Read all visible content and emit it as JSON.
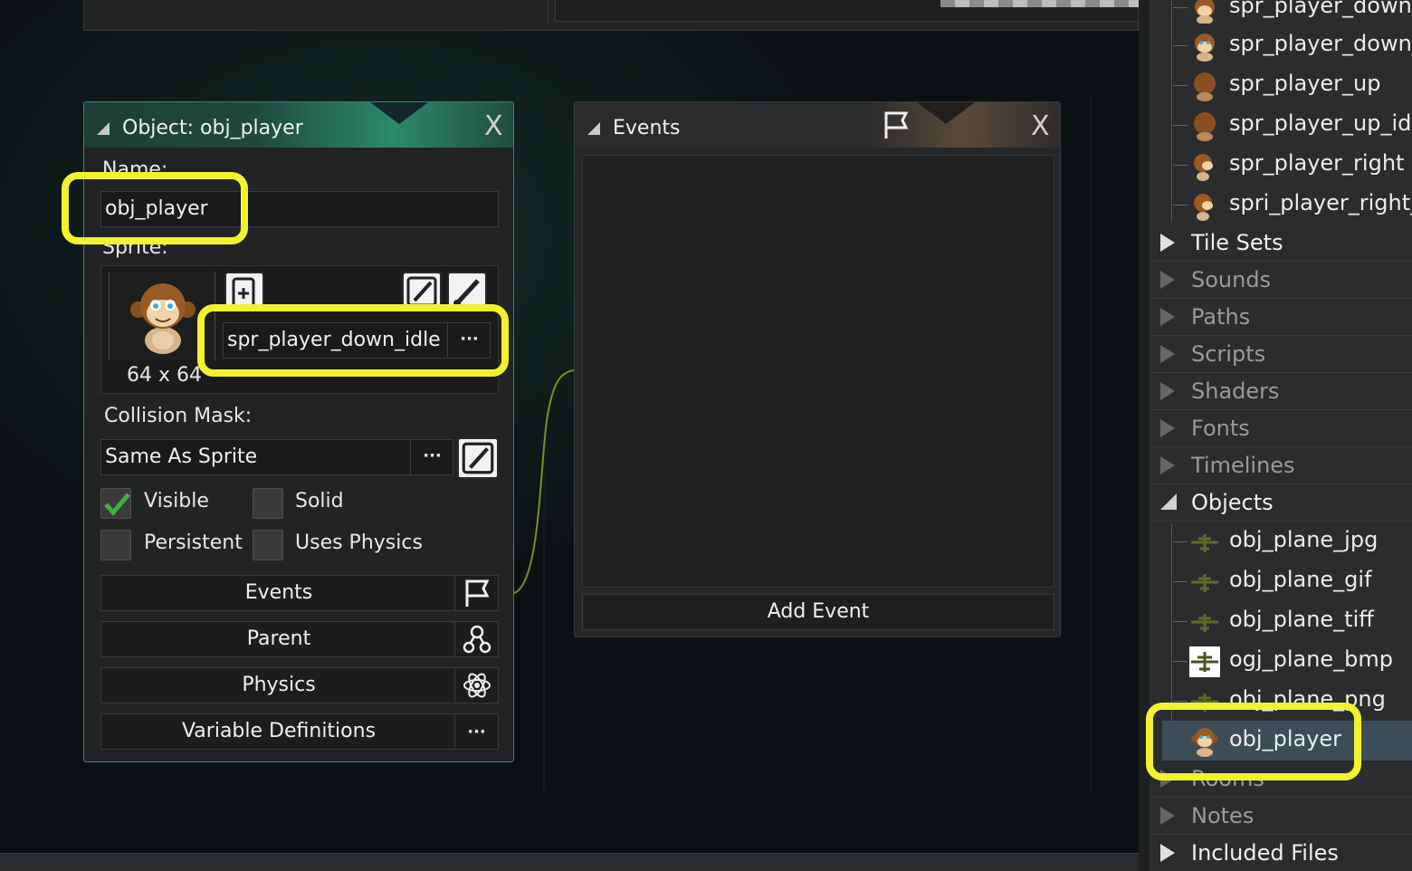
{
  "object_panel": {
    "title": "Object: obj_player",
    "name_label": "Name:",
    "name_value": "obj_player",
    "sprite_label": "Sprite:",
    "sprite_size": "64 x 64",
    "sprite_value": "spr_player_down_idle",
    "collision_label": "Collision Mask:",
    "collision_value": "Same As Sprite",
    "checkboxes": [
      {
        "label": "Visible",
        "checked": true
      },
      {
        "label": "Solid",
        "checked": false
      },
      {
        "label": "Persistent",
        "checked": false
      },
      {
        "label": "Uses Physics",
        "checked": false
      }
    ],
    "buttons": {
      "events": "Events",
      "parent": "Parent",
      "physics": "Physics",
      "variable_definitions": "Variable Definitions"
    },
    "ellipsis": "···",
    "close_label": "X"
  },
  "events_panel": {
    "title": "Events",
    "add_event": "Add Event",
    "close_label": "X"
  },
  "resource_tree": {
    "sprites_children": [
      "spr_player_down",
      "spr_player_down_",
      "spr_player_up",
      "spr_player_up_idle",
      "spr_player_right",
      "spri_player_right_i"
    ],
    "groups_a": [
      "Tile Sets",
      "Sounds",
      "Paths",
      "Scripts",
      "Shaders",
      "Fonts",
      "Timelines"
    ],
    "objects_group": "Objects",
    "objects_children": [
      "obj_plane_jpg",
      "obj_plane_gif",
      "obj_plane_tiff",
      "ogj_plane_bmp",
      "obj_plane_png",
      "obj_player"
    ],
    "groups_b": [
      "Rooms",
      "Notes",
      "Included Files"
    ]
  },
  "colors": {
    "highlight": "#f2f22e",
    "panel_accent": "#2f8a6f",
    "selected_row": "#3d4d57"
  },
  "icons": [
    "close-icon",
    "flag-icon",
    "parent-icon",
    "physics-atom-icon",
    "edit-sprite-icon",
    "new-sprite-icon",
    "monkey-sprite-icon",
    "plane-icon"
  ]
}
